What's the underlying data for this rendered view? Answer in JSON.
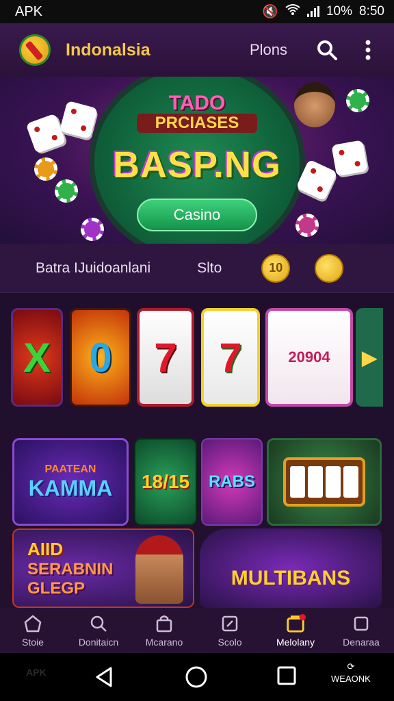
{
  "status_bar": {
    "carrier": "APK",
    "battery": "10%",
    "time": "8:50"
  },
  "app_bar": {
    "brand": "Indonalsia",
    "plans_label": "Plons"
  },
  "hero": {
    "subtitle_top": "TADO",
    "subtitle_bottom": "PRCIASES",
    "title": "BASP.NG",
    "button_label": "Casino"
  },
  "categories": {
    "left_label": "Batra IJuidoanlani",
    "right_label": "Slto",
    "coin_label": "10"
  },
  "slots": [
    {
      "glyph": "X",
      "colors": [
        "#c0191b",
        "#3cc23c"
      ]
    },
    {
      "glyph": "0",
      "colors": [
        "#ff8a00",
        "#2aa8e0"
      ]
    },
    {
      "glyph": "7",
      "colors": [
        "#f2f2f2",
        "#e0182a"
      ]
    },
    {
      "glyph": "7",
      "colors": [
        "#ffe34a",
        "#e0182a"
      ]
    },
    {
      "glyph": "20904",
      "colors": [
        "#ffffff",
        "#c41b58"
      ]
    }
  ],
  "games": [
    {
      "label": "KAMMA",
      "sub": "PAATEAN"
    },
    {
      "label": "18/15"
    },
    {
      "label": "RABS"
    },
    {
      "label": ""
    },
    {
      "label": "SERABNIN GLEGP",
      "badge": "AIID"
    },
    {
      "label": "MULTIBANS"
    }
  ],
  "bottom_nav": [
    {
      "label": "Stoie",
      "icon": "home-icon"
    },
    {
      "label": "Donitaicn",
      "icon": "search-icon"
    },
    {
      "label": "Mcarano",
      "icon": "bag-icon"
    },
    {
      "label": "Scolo",
      "icon": "ticket-icon"
    },
    {
      "label": "Melolany",
      "icon": "cart-icon"
    },
    {
      "label": "Denaraa",
      "icon": "square-icon"
    }
  ],
  "system_nav": {
    "right_label": "WEAONK",
    "watermark": "APK"
  }
}
